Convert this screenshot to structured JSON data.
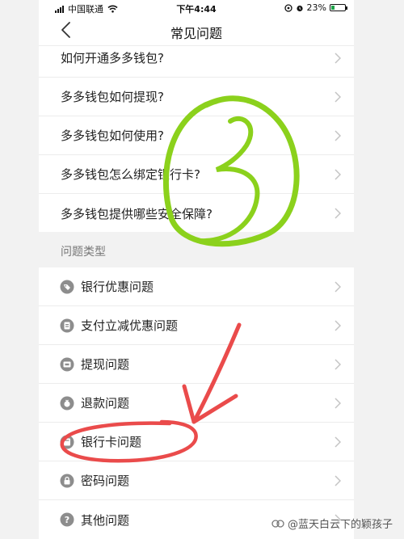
{
  "status_bar": {
    "carrier": "中国联通",
    "time": "下午4:44",
    "battery": "23%",
    "battery_level": 0.23
  },
  "nav": {
    "title": "常见问题",
    "back_icon": "chevron-left-icon"
  },
  "faq_items": [
    "如何开通多多钱包?",
    "多多钱包如何提现?",
    "多多钱包如何使用?",
    "多多钱包怎么绑定银行卡?",
    "多多钱包提供哪些安全保障?"
  ],
  "section": {
    "title": "问题类型"
  },
  "categories": [
    {
      "label": "银行优惠问题",
      "icon": "tag-icon"
    },
    {
      "label": "支付立减优惠问题",
      "icon": "receipt-icon"
    },
    {
      "label": "提现问题",
      "icon": "withdraw-icon"
    },
    {
      "label": "退款问题",
      "icon": "refund-icon"
    },
    {
      "label": "银行卡问题",
      "icon": "bank-card-icon"
    },
    {
      "label": "密码问题",
      "icon": "lock-icon"
    },
    {
      "label": "其他问题",
      "icon": "question-icon"
    }
  ],
  "annotations": {
    "circle_number": "3",
    "circle_color": "#8bd11c",
    "arrow_color": "#ea4b4b"
  },
  "watermark": "@蓝天白云下的颖孩子",
  "colors": {
    "icon_gray": "#8d8d8d",
    "chevron": "#c4c4c4",
    "divider": "#ececec"
  }
}
